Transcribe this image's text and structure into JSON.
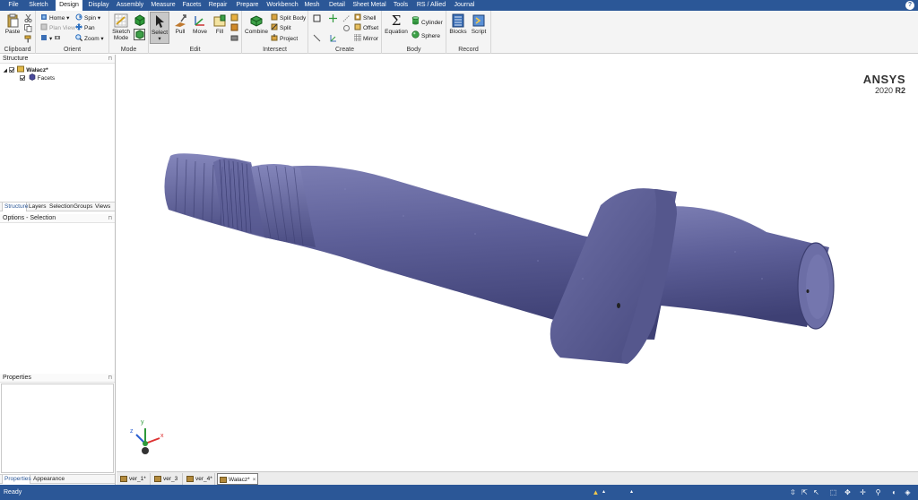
{
  "menu": {
    "tabs": [
      "File",
      "Sketch",
      "Design",
      "Display",
      "Assembly",
      "Measure",
      "Facets",
      "Repair",
      "Prepare",
      "Workbench",
      "Mesh",
      "Detail",
      "Sheet Metal",
      "Tools",
      "RS / Allied",
      "Journal"
    ],
    "active": "Design",
    "help": "?"
  },
  "ribbon": {
    "clipboard": {
      "label": "Clipboard",
      "paste": "Paste"
    },
    "orient": {
      "label": "Orient",
      "home": "Home",
      "plan_view": "Plan View",
      "spin": "Spin",
      "pan": "Pan",
      "zoom": "Zoom"
    },
    "mode": {
      "label": "Mode",
      "sketch_mode": "Sketch Mode"
    },
    "edit": {
      "label": "Edit",
      "select": "Select",
      "pull": "Pull",
      "move": "Move",
      "fill": "Fill"
    },
    "intersect": {
      "label": "Intersect",
      "combine": "Combine",
      "split_body": "Split Body",
      "split": "Split",
      "project": "Project"
    },
    "create": {
      "label": "Create",
      "shell": "Shell",
      "offset": "Offset",
      "mirror": "Mirror"
    },
    "body": {
      "label": "Body",
      "equation": "Equation",
      "cylinder": "Cylinder",
      "sphere": "Sphere"
    },
    "record": {
      "label": "Record",
      "blocks": "Blocks",
      "script": "Script"
    }
  },
  "structure": {
    "title": "Structure",
    "root": "Wałacz*",
    "child": "Facets",
    "tabs": [
      "Structure",
      "Layers",
      "Selection",
      "Groups",
      "Views"
    ],
    "active_tab": "Structure"
  },
  "options": {
    "title": "Options - Selection"
  },
  "properties": {
    "title": "Properties",
    "tabs": [
      "Properties",
      "Appearance"
    ],
    "active_tab": "Properties"
  },
  "brand": {
    "name": "ANSYS",
    "version": "2020",
    "release": "R2"
  },
  "axes": {
    "x": "x",
    "y": "y",
    "z": "z"
  },
  "doc_tabs": [
    {
      "label": "ver_1*",
      "active": false
    },
    {
      "label": "ver_3",
      "active": false
    },
    {
      "label": "ver_4*",
      "active": false
    },
    {
      "label": "Wałacz*",
      "active": true
    }
  ],
  "doc_close": "×",
  "status": {
    "text": "Ready"
  },
  "colors": {
    "accent": "#2b5797",
    "model": "#5d5f98"
  }
}
